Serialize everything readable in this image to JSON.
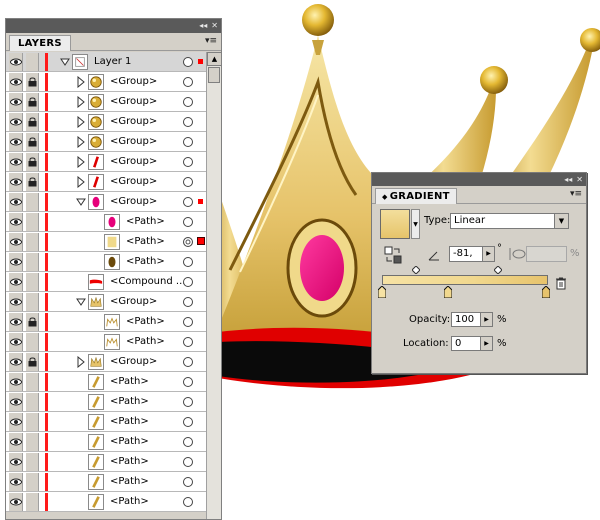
{
  "layers_panel": {
    "tab_label": "LAYERS",
    "collapse_glyph": "◂◂",
    "close_glyph": "✕",
    "menu_glyph": "▾≡",
    "rows": [
      {
        "label": "Layer 1",
        "thumb": "layer-thumb",
        "arrow": "down",
        "depth": 0,
        "locked": false,
        "selected_box": "small",
        "target": "single",
        "top": true
      },
      {
        "label": "<Group>",
        "thumb": "ball",
        "arrow": "right",
        "depth": 1,
        "locked": true,
        "selected_box": "",
        "target": "single"
      },
      {
        "label": "<Group>",
        "thumb": "ball",
        "arrow": "right",
        "depth": 1,
        "locked": true,
        "selected_box": "",
        "target": "single"
      },
      {
        "label": "<Group>",
        "thumb": "ball",
        "arrow": "right",
        "depth": 1,
        "locked": true,
        "selected_box": "",
        "target": "single"
      },
      {
        "label": "<Group>",
        "thumb": "ball",
        "arrow": "right",
        "depth": 1,
        "locked": true,
        "selected_box": "",
        "target": "single"
      },
      {
        "label": "<Group>",
        "thumb": "slash-red",
        "arrow": "right",
        "depth": 1,
        "locked": true,
        "selected_box": "",
        "target": "single"
      },
      {
        "label": "<Group>",
        "thumb": "slash-red",
        "arrow": "right",
        "depth": 1,
        "locked": true,
        "selected_box": "",
        "target": "single"
      },
      {
        "label": "<Group>",
        "thumb": "pink-oval",
        "arrow": "down",
        "depth": 1,
        "locked": false,
        "selected_box": "small",
        "target": "single"
      },
      {
        "label": "<Path>",
        "thumb": "pink-oval",
        "arrow": "",
        "depth": 2,
        "locked": false,
        "selected_box": "",
        "target": "single"
      },
      {
        "label": "<Path>",
        "thumb": "gold-rect",
        "arrow": "",
        "depth": 2,
        "locked": false,
        "selected_box": "big",
        "target": "double"
      },
      {
        "label": "<Path>",
        "thumb": "brown-oval",
        "arrow": "",
        "depth": 2,
        "locked": false,
        "selected_box": "",
        "target": "single"
      },
      {
        "label": "<Compound ...",
        "thumb": "compound",
        "arrow": "",
        "depth": 1,
        "locked": false,
        "selected_box": "",
        "target": "single"
      },
      {
        "label": "<Group>",
        "thumb": "crown",
        "arrow": "down",
        "depth": 1,
        "locked": false,
        "selected_box": "",
        "target": "single"
      },
      {
        "label": "<Path>",
        "thumb": "crown-outline",
        "arrow": "",
        "depth": 2,
        "locked": true,
        "selected_box": "",
        "target": "single"
      },
      {
        "label": "<Path>",
        "thumb": "crown-outline",
        "arrow": "",
        "depth": 2,
        "locked": false,
        "selected_box": "",
        "target": "single"
      },
      {
        "label": "<Group>",
        "thumb": "crown",
        "arrow": "right",
        "depth": 1,
        "locked": true,
        "selected_box": "",
        "target": "single"
      },
      {
        "label": "<Path>",
        "thumb": "slash-gold",
        "arrow": "",
        "depth": 1,
        "locked": false,
        "selected_box": "",
        "target": "single"
      },
      {
        "label": "<Path>",
        "thumb": "slash-gold",
        "arrow": "",
        "depth": 1,
        "locked": false,
        "selected_box": "",
        "target": "single"
      },
      {
        "label": "<Path>",
        "thumb": "slash-gold",
        "arrow": "",
        "depth": 1,
        "locked": false,
        "selected_box": "",
        "target": "single"
      },
      {
        "label": "<Path>",
        "thumb": "slash-gold",
        "arrow": "",
        "depth": 1,
        "locked": false,
        "selected_box": "",
        "target": "single"
      },
      {
        "label": "<Path>",
        "thumb": "slash-gold",
        "arrow": "",
        "depth": 1,
        "locked": false,
        "selected_box": "",
        "target": "single"
      },
      {
        "label": "<Path>",
        "thumb": "slash-gold",
        "arrow": "",
        "depth": 1,
        "locked": false,
        "selected_box": "",
        "target": "single"
      },
      {
        "label": "<Path>",
        "thumb": "slash-gold",
        "arrow": "",
        "depth": 1,
        "locked": false,
        "selected_box": "",
        "target": "single"
      }
    ]
  },
  "gradient_panel": {
    "tab_label": "GRADIENT",
    "tab_swap_glyph": "◆",
    "collapse_glyph": "◂◂",
    "close_glyph": "✕",
    "menu_glyph": "▾≡",
    "type_label": "Type:",
    "type_value": "Linear",
    "angle_value": "-81,",
    "degree_mark": "°",
    "aspect_pct": "%",
    "opacity_label": "Opacity:",
    "opacity_value": "100",
    "opacity_unit": "%",
    "location_label": "Location:",
    "location_value": "0",
    "location_unit": "%",
    "colors": {
      "start": "#f6e2a4",
      "mid": "#f1d88e",
      "end": "#e7c36c"
    }
  },
  "artwork": {
    "colors": {
      "gold_light": "#f2dc8c",
      "gold_mid": "#d9b34a",
      "gold_dark": "#8a6a14",
      "gem_pink": "#e6007a",
      "band_red": "#e00000",
      "opening_black": "#0a0a0a"
    }
  }
}
